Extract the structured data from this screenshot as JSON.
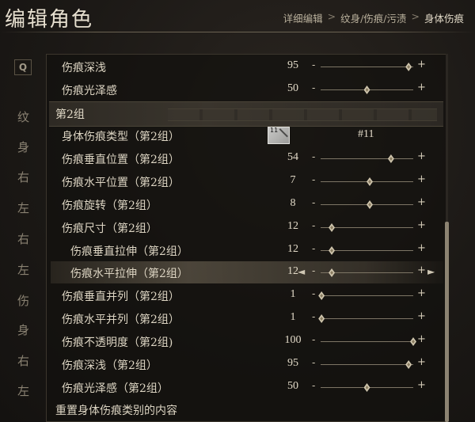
{
  "header": {
    "title": "编辑角色",
    "breadcrumb": [
      "详细编辑",
      "纹身/伤痕/污渍",
      "身体伤痕"
    ],
    "breadcrumb_sep": ">"
  },
  "sidebar": {
    "search_icon_text": "Q",
    "items": [
      "纹",
      "身",
      "右",
      "左",
      "右",
      "左",
      "伤",
      "身",
      "右",
      "左"
    ]
  },
  "rows": [
    {
      "label": "伤痕深浅",
      "value": "95",
      "fraction": 0.95,
      "sub": false
    },
    {
      "label": "伤痕光泽感",
      "value": "50",
      "fraction": 0.5,
      "sub": false
    },
    {
      "label": "伤痕垂直位置（第2组）",
      "value": "54",
      "fraction": 0.76,
      "sub": false
    },
    {
      "label": "伤痕水平位置（第2组）",
      "value": "7",
      "fraction": 0.53,
      "sub": false
    },
    {
      "label": "伤痕旋转（第2组）",
      "value": "8",
      "fraction": 0.53,
      "sub": false
    },
    {
      "label": "伤痕尺寸（第2组）",
      "value": "12",
      "fraction": 0.12,
      "sub": false
    },
    {
      "label": "伤痕垂直拉伸（第2组）",
      "value": "12",
      "fraction": 0.12,
      "sub": true
    },
    {
      "label": "伤痕水平拉伸（第2组）",
      "value": "12",
      "fraction": 0.12,
      "sub": true,
      "selected": true
    },
    {
      "label": "伤痕垂直并列（第2组）",
      "value": "1",
      "fraction": 0.01,
      "sub": false
    },
    {
      "label": "伤痕水平并列（第2组）",
      "value": "1",
      "fraction": 0.01,
      "sub": false
    },
    {
      "label": "伤痕不透明度（第2组)",
      "value": "100",
      "fraction": 1.0,
      "sub": false
    },
    {
      "label": "伤痕深浅（第2组）",
      "value": "95",
      "fraction": 0.95,
      "sub": false
    },
    {
      "label": "伤痕光泽感（第2组）",
      "value": "50",
      "fraction": 0.5,
      "sub": false
    }
  ],
  "group": {
    "label": "第2组"
  },
  "type_row": {
    "label": "身体伤痕类型（第2组）",
    "swatch_number": "11",
    "value": "#11"
  },
  "controls": {
    "minus": "-",
    "plus": "+",
    "arrow_left": "◄",
    "arrow_right": "►"
  },
  "footer": {
    "reset_label": "重置身体伤痕类别的内容"
  }
}
